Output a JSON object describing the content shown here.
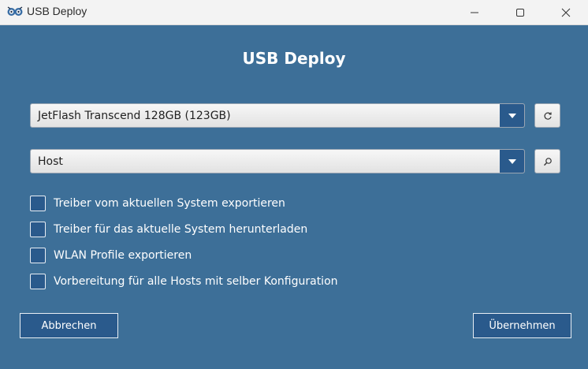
{
  "window": {
    "title": "USB Deploy"
  },
  "heading": "USB Deploy",
  "device_select": {
    "value": "JetFlash Transcend 128GB (123GB)",
    "arrow_icon": "chevron-down-icon",
    "side_button_icon": "refresh-icon"
  },
  "host_select": {
    "value": "Host",
    "arrow_icon": "chevron-down-icon",
    "side_button_icon": "search-icon"
  },
  "options": [
    {
      "label": "Treiber vom aktuellen System exportieren",
      "checked": false
    },
    {
      "label": "Treiber für das aktuelle System herunterladen",
      "checked": false
    },
    {
      "label": "WLAN Profile exportieren",
      "checked": false
    },
    {
      "label": "Vorbereitung für alle Hosts mit selber Konfiguration",
      "checked": false
    }
  ],
  "buttons": {
    "cancel": "Abbrechen",
    "apply": "Übernehmen"
  },
  "colors": {
    "background": "#3d6f98",
    "accent": "#2a5a8c",
    "titlebar": "#f3f3f3"
  }
}
